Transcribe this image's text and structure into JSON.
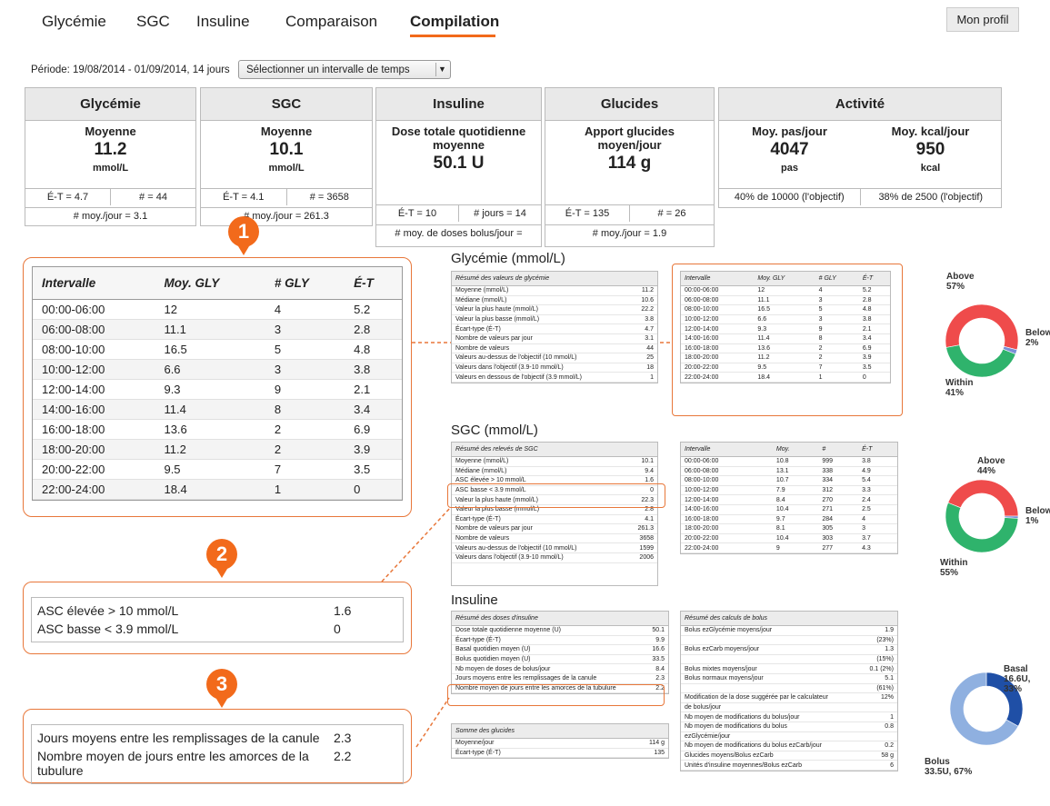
{
  "nav": {
    "tabs": [
      "Glycémie",
      "SGC",
      "Insuline",
      "Comparaison",
      "Compilation"
    ],
    "profile_label": "Mon profil"
  },
  "period": {
    "text": "Période: 19/08/2014 - 01/09/2014, 14 jours",
    "select_label": "Sélectionner un intervalle de temps"
  },
  "cards": {
    "glycemie": {
      "title": "Glycémie",
      "label": "Moyenne",
      "value": "11.2",
      "unit": "mmol/L",
      "et": "É-T = 4.7",
      "n": "# = 44",
      "per_day": "# moy./jour = 3.1"
    },
    "sgc": {
      "title": "SGC",
      "label": "Moyenne",
      "value": "10.1",
      "unit": "mmol/L",
      "et": "É-T = 4.1",
      "n": "# = 3658",
      "per_day": "# moy./jour = 261.3"
    },
    "insuline": {
      "title": "Insuline",
      "label": "Dose totale quotidienne moyenne",
      "value": "50.1 U",
      "et": "É-T = 10",
      "days": "# jours = 14",
      "bolus": "# moy. de doses bolus/jour ="
    },
    "glucides": {
      "title": "Glucides",
      "label": "Apport glucides moyen/jour",
      "value": "114 g",
      "et": "É-T = 135",
      "n": "# = 26",
      "per_day": "# moy./jour = 1.9"
    },
    "activite": {
      "title": "Activité",
      "steps_label": "Moy. pas/jour",
      "steps_value": "4047",
      "steps_unit": "pas",
      "steps_goal": "40% de 10000 (l'objectif)",
      "kcal_label": "Moy. kcal/jour",
      "kcal_value": "950",
      "kcal_unit": "kcal",
      "kcal_goal": "38% de 2500 (l'objectif)"
    }
  },
  "callouts": {
    "badge1": "1",
    "badge2": "2",
    "badge3": "3",
    "zoom1": {
      "headers": [
        "Intervalle",
        "Moy. GLY",
        "# GLY",
        "É-T"
      ],
      "rows": [
        [
          "00:00-06:00",
          "12",
          "4",
          "5.2"
        ],
        [
          "06:00-08:00",
          "11.1",
          "3",
          "2.8"
        ],
        [
          "08:00-10:00",
          "16.5",
          "5",
          "4.8"
        ],
        [
          "10:00-12:00",
          "6.6",
          "3",
          "3.8"
        ],
        [
          "12:00-14:00",
          "9.3",
          "9",
          "2.1"
        ],
        [
          "14:00-16:00",
          "11.4",
          "8",
          "3.4"
        ],
        [
          "16:00-18:00",
          "13.6",
          "2",
          "6.9"
        ],
        [
          "18:00-20:00",
          "11.2",
          "2",
          "3.9"
        ],
        [
          "20:00-22:00",
          "9.5",
          "7",
          "3.5"
        ],
        [
          "22:00-24:00",
          "18.4",
          "1",
          "0"
        ]
      ]
    },
    "zoom2": {
      "rows": [
        [
          "ASC élevée > 10 mmol/L",
          "1.6"
        ],
        [
          "ASC basse < 3.9 mmol/L",
          "0"
        ]
      ]
    },
    "zoom3": {
      "rows": [
        [
          "Jours moyens entre les remplissages de la canule",
          "2.3"
        ],
        [
          "Nombre moyen de jours entre les amorces de la tubulure",
          "2.2"
        ]
      ]
    }
  },
  "report": {
    "gly_title": "Glycémie (mmol/L)",
    "gly_summary_header": "Résumé des valeurs de glycémie",
    "gly_summary": [
      [
        "Moyenne (mmol/L)",
        "11.2"
      ],
      [
        "Médiane (mmol/L)",
        "10.6"
      ],
      [
        "Valeur la plus haute (mmol/L)",
        "22.2"
      ],
      [
        "Valeur la plus basse (mmol/L)",
        "3.8"
      ],
      [
        "Écart-type (É-T)",
        "4.7"
      ],
      [
        "Nombre de valeurs par jour",
        "3.1"
      ],
      [
        "Nombre de valeurs",
        "44"
      ],
      [
        "Valeurs au-dessus de l'objectif (10 mmol/L)",
        "25"
      ],
      [
        "Valeurs dans l'objectif (3.9-10 mmol/L)",
        "18"
      ],
      [
        "Valeurs en dessous de l'objectif (3.9 mmol/L)",
        "1"
      ]
    ],
    "gly_interval_headers": [
      "Intervalle",
      "Moy. GLY",
      "# GLY",
      "É-T"
    ],
    "sgc_title": "SGC (mmol/L)",
    "sgc_summary_header": "Résumé des relevés de SGC",
    "sgc_summary": [
      [
        "Moyenne (mmol/L)",
        "10.1"
      ],
      [
        "Médiane (mmol/L)",
        "9.4"
      ],
      [
        "ASC élevée > 10 mmol/L",
        "1.6"
      ],
      [
        "ASC basse < 3.9 mmol/L",
        "0"
      ],
      [
        "Valeur la plus haute (mmol/L)",
        "22.3"
      ],
      [
        "Valeur la plus basse (mmol/L)",
        "2.8"
      ],
      [
        "Écart-type (É-T)",
        "4.1"
      ],
      [
        "Nombre de valeurs par jour",
        "261.3"
      ],
      [
        "Nombre de valeurs",
        "3658"
      ],
      [
        "Valeurs au-dessus de l'objectif (10 mmol/L)",
        "1599"
      ],
      [
        "Valeurs dans l'objectif (3.9-10 mmol/L)",
        "2006"
      ]
    ],
    "sgc_interval_headers": [
      "Intervalle",
      "Moy.",
      "#",
      "É-T"
    ],
    "sgc_intervals": [
      [
        "00:00-06:00",
        "10.8",
        "999",
        "3.8"
      ],
      [
        "06:00-08:00",
        "13.1",
        "338",
        "4.9"
      ],
      [
        "08:00-10:00",
        "10.7",
        "334",
        "5.4"
      ],
      [
        "10:00-12:00",
        "7.9",
        "312",
        "3.3"
      ],
      [
        "12:00-14:00",
        "8.4",
        "270",
        "2.4"
      ],
      [
        "14:00-16:00",
        "10.4",
        "271",
        "2.5"
      ],
      [
        "16:00-18:00",
        "9.7",
        "284",
        "4"
      ],
      [
        "18:00-20:00",
        "8.1",
        "305",
        "3"
      ],
      [
        "20:00-22:00",
        "10.4",
        "303",
        "3.7"
      ],
      [
        "22:00-24:00",
        "9",
        "277",
        "4.3"
      ]
    ],
    "ins_title": "Insuline",
    "ins_summary_header": "Résumé des doses d'insuline",
    "ins_summary": [
      [
        "Dose totale quotidienne moyenne (U)",
        "50.1"
      ],
      [
        "Écart-type (É-T)",
        "9.9"
      ],
      [
        "Basal quotidien moyen (U)",
        "16.6"
      ],
      [
        "Bolus quotidien moyen (U)",
        "33.5"
      ],
      [
        "Nb moyen de doses de bolus/jour",
        "8.4"
      ],
      [
        "Jours moyens entre les remplissages de la canule",
        "2.3"
      ],
      [
        "Nombre moyen de jours entre les amorces de la tubulure",
        "2.2"
      ]
    ],
    "carb_header": "Somme des glucides",
    "carb_rows": [
      [
        "Moyenne/jour",
        "114 g"
      ],
      [
        "Écart-type (É-T)",
        "135"
      ]
    ],
    "bolus_header": "Résumé des calculs de bolus",
    "bolus_rows": [
      [
        "Bolus ezGlycémie moyens/jour",
        "1.9"
      ],
      [
        "",
        "(23%)"
      ],
      [
        "Bolus ezCarb moyens/jour",
        "1.3"
      ],
      [
        "",
        "(15%)"
      ],
      [
        "Bolus mixtes moyens/jour",
        "0.1 (2%)"
      ],
      [
        "Bolus normaux moyens/jour",
        "5.1"
      ],
      [
        "",
        "(61%)"
      ],
      [
        "Modification de la dose suggérée par le calculateur",
        "12%"
      ],
      [
        "de bolus/jour",
        ""
      ],
      [
        "Nb moyen de modifications du bolus/jour",
        "1"
      ],
      [
        "Nb moyen de modifications du bolus",
        "0.8"
      ],
      [
        "ezGlycémie/jour",
        ""
      ],
      [
        "Nb moyen de modifications du bolus ezCarb/jour",
        "0.2"
      ],
      [
        "Glucides moyens/Bolus ezCarb",
        "58 g"
      ],
      [
        "Unités d'insuline moyennes/Bolus ezCarb",
        "6"
      ]
    ]
  },
  "donuts": {
    "gly": {
      "above_label": "Above",
      "above_pct": "57%",
      "below_label": "Below",
      "below_pct": "2%",
      "within_label": "Within",
      "within_pct": "41%",
      "values": [
        57,
        2,
        41
      ]
    },
    "sgc": {
      "above_label": "Above",
      "above_pct": "44%",
      "below_label": "Below",
      "below_pct": "1%",
      "within_label": "Within",
      "within_pct": "55%",
      "values": [
        44,
        1,
        55
      ]
    },
    "ins": {
      "basal_label": "Basal",
      "basal_value": "16.6U, 33%",
      "bolus_label": "Bolus",
      "bolus_value": "33.5U, 67%",
      "values": [
        33,
        67
      ]
    },
    "colors": {
      "above": "#ef4b4b",
      "below": "#7a8fd6",
      "within": "#2fb36c",
      "basal": "#1f4fa6",
      "bolus": "#8fb0e0"
    }
  }
}
